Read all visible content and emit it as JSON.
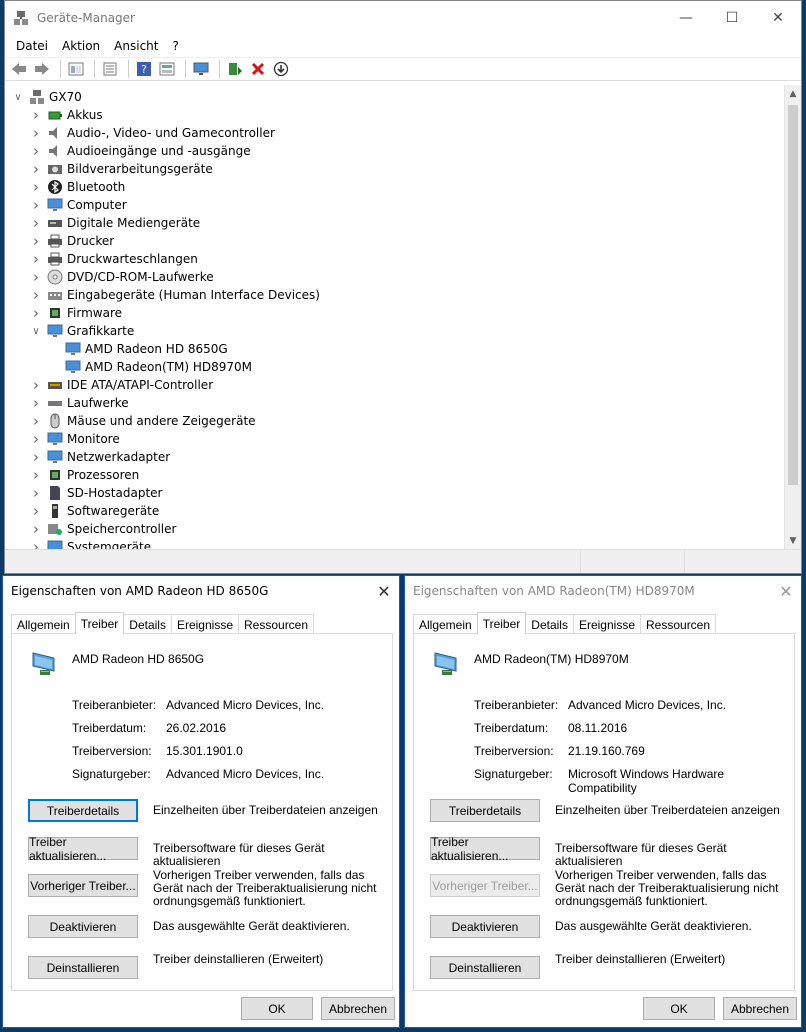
{
  "device_manager": {
    "title": "Geräte-Manager",
    "menu": [
      "Datei",
      "Aktion",
      "Ansicht",
      "?"
    ],
    "toolbar_icons": [
      "back-icon",
      "forward-icon",
      "tree-view-icon",
      "properties-icon",
      "help-icon",
      "devices-view-icon",
      "monitor-icon",
      "update-driver-icon",
      "remove-icon",
      "scan-icon"
    ],
    "root": "GX70",
    "categories": [
      {
        "label": "Akkus",
        "icon": "battery",
        "expanded": false
      },
      {
        "label": "Audio-, Video- und Gamecontroller",
        "icon": "speaker",
        "expanded": false
      },
      {
        "label": "Audioeingänge und -ausgänge",
        "icon": "speaker",
        "expanded": false
      },
      {
        "label": "Bildverarbeitungsgeräte",
        "icon": "camera",
        "expanded": false
      },
      {
        "label": "Bluetooth",
        "icon": "bluetooth",
        "expanded": false
      },
      {
        "label": "Computer",
        "icon": "monitor",
        "expanded": false
      },
      {
        "label": "Digitale Mediengeräte",
        "icon": "media",
        "expanded": false
      },
      {
        "label": "Drucker",
        "icon": "printer",
        "expanded": false
      },
      {
        "label": "Druckwarteschlangen",
        "icon": "printer",
        "expanded": false
      },
      {
        "label": "DVD/CD-ROM-Laufwerke",
        "icon": "dvd",
        "expanded": false
      },
      {
        "label": "Eingabegeräte (Human Interface Devices)",
        "icon": "hid",
        "expanded": false
      },
      {
        "label": "Firmware",
        "icon": "chip",
        "expanded": false
      },
      {
        "label": "Grafikkarte",
        "icon": "monitor",
        "expanded": true,
        "children": [
          "AMD Radeon HD 8650G",
          "AMD Radeon(TM) HD8970M"
        ]
      },
      {
        "label": "IDE ATA/ATAPI-Controller",
        "icon": "ide",
        "expanded": false
      },
      {
        "label": "Laufwerke",
        "icon": "drive",
        "expanded": false
      },
      {
        "label": "Mäuse und andere Zeigegeräte",
        "icon": "mouse",
        "expanded": false
      },
      {
        "label": "Monitore",
        "icon": "monitor",
        "expanded": false
      },
      {
        "label": "Netzwerkadapter",
        "icon": "monitor",
        "expanded": false
      },
      {
        "label": "Prozessoren",
        "icon": "chip",
        "expanded": false
      },
      {
        "label": "SD-Hostadapter",
        "icon": "sd",
        "expanded": false
      },
      {
        "label": "Softwaregeräte",
        "icon": "usb",
        "expanded": false
      },
      {
        "label": "Speichercontroller",
        "icon": "storage",
        "expanded": false
      },
      {
        "label": "Systemgeräte",
        "icon": "monitor",
        "expanded": false
      }
    ]
  },
  "dialogs": [
    {
      "title": "Eigenschaften von AMD Radeon HD 8650G",
      "active": true,
      "tabs": [
        "Allgemein",
        "Treiber",
        "Details",
        "Ereignisse",
        "Ressourcen"
      ],
      "active_tab": "Treiber",
      "device_name": "AMD Radeon HD 8650G",
      "props": [
        {
          "label": "Treiberanbieter:",
          "value": "Advanced Micro Devices, Inc."
        },
        {
          "label": "Treiberdatum:",
          "value": "26.02.2016"
        },
        {
          "label": "Treiberversion:",
          "value": "15.301.1901.0"
        },
        {
          "label": "Signaturgeber:",
          "value": "Advanced Micro Devices, Inc."
        }
      ],
      "buttons": [
        {
          "label": "Treiberdetails",
          "desc": "Einzelheiten über Treiberdateien anzeigen",
          "disabled": false
        },
        {
          "label": "Treiber aktualisieren...",
          "desc": "Treibersoftware für dieses Gerät aktualisieren",
          "disabled": false
        },
        {
          "label": "Vorheriger Treiber...",
          "desc": "Vorherigen Treiber verwenden, falls das Gerät nach der Treiberaktualisierung nicht ordnungsgemäß funktioniert.",
          "disabled": false
        },
        {
          "label": "Deaktivieren",
          "desc": "Das ausgewählte Gerät deaktivieren.",
          "disabled": false
        },
        {
          "label": "Deinstallieren",
          "desc": "Treiber deinstallieren (Erweitert)",
          "disabled": false
        }
      ],
      "ok": "OK",
      "cancel": "Abbrechen"
    },
    {
      "title": "Eigenschaften von AMD Radeon(TM) HD8970M",
      "active": false,
      "tabs": [
        "Allgemein",
        "Treiber",
        "Details",
        "Ereignisse",
        "Ressourcen"
      ],
      "active_tab": "Treiber",
      "device_name": "AMD Radeon(TM) HD8970M",
      "props": [
        {
          "label": "Treiberanbieter:",
          "value": "Advanced Micro Devices, Inc."
        },
        {
          "label": "Treiberdatum:",
          "value": "08.11.2016"
        },
        {
          "label": "Treiberversion:",
          "value": "21.19.160.769"
        },
        {
          "label": "Signaturgeber:",
          "value": "Microsoft Windows Hardware Compatibility"
        }
      ],
      "buttons": [
        {
          "label": "Treiberdetails",
          "desc": "Einzelheiten über Treiberdateien anzeigen",
          "disabled": false
        },
        {
          "label": "Treiber aktualisieren...",
          "desc": "Treibersoftware für dieses Gerät aktualisieren",
          "disabled": false
        },
        {
          "label": "Vorheriger Treiber...",
          "desc": "Vorherigen Treiber verwenden, falls das Gerät nach der Treiberaktualisierung nicht ordnungsgemäß funktioniert.",
          "disabled": true
        },
        {
          "label": "Deaktivieren",
          "desc": "Das ausgewählte Gerät deaktivieren.",
          "disabled": false
        },
        {
          "label": "Deinstallieren",
          "desc": "Treiber deinstallieren (Erweitert)",
          "disabled": false
        }
      ],
      "ok": "OK",
      "cancel": "Abbrechen"
    }
  ],
  "colors": {
    "accent": "#1a5fa8",
    "focus": "#0078d7",
    "desktop": "#0b3a66"
  }
}
